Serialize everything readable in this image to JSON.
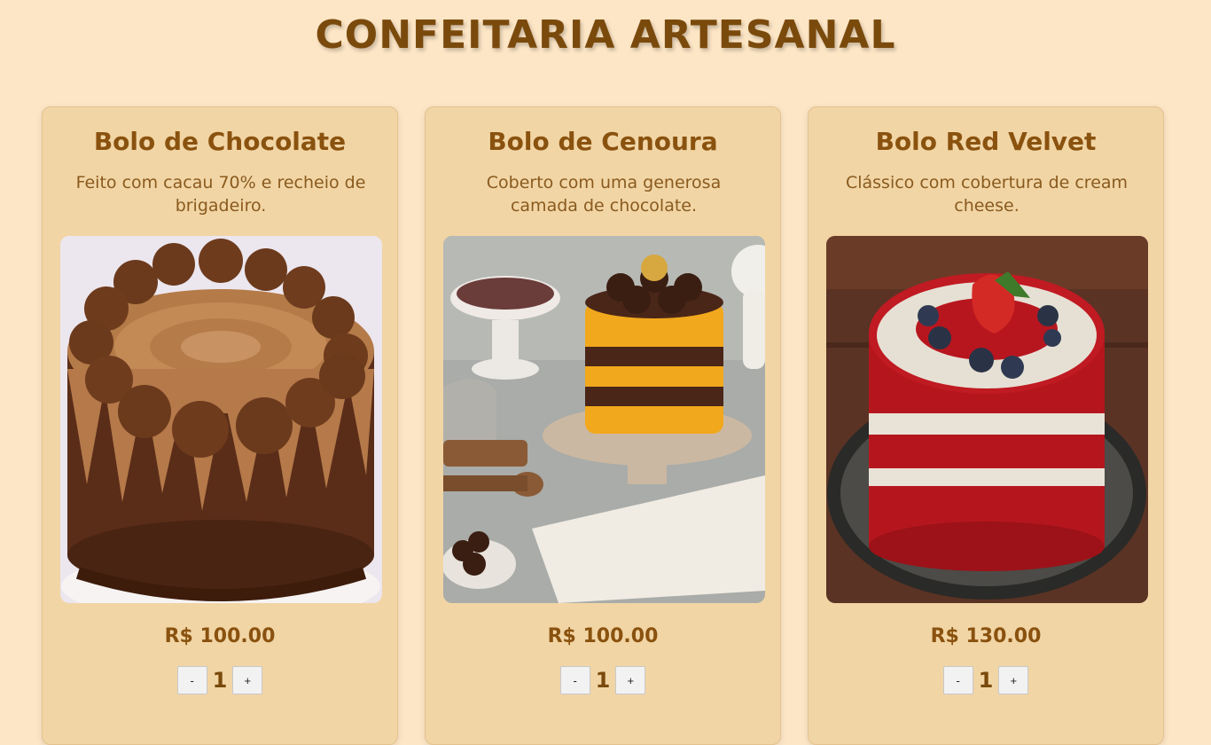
{
  "page": {
    "title": "CONFEITARIA ARTESANAL"
  },
  "products": [
    {
      "name": "Bolo de Chocolate",
      "description": "Feito com cacau 70% e recheio de brigadeiro.",
      "price": "R$ 100.00",
      "quantity": "1",
      "decrement_label": "-",
      "increment_label": "+"
    },
    {
      "name": "Bolo de Cenoura",
      "description": "Coberto com uma generosa camada de chocolate.",
      "price": "R$ 100.00",
      "quantity": "1",
      "decrement_label": "-",
      "increment_label": "+"
    },
    {
      "name": "Bolo Red Velvet",
      "description": "Clássico com cobertura de cream cheese.",
      "price": "R$ 130.00",
      "quantity": "1",
      "decrement_label": "-",
      "increment_label": "+"
    }
  ],
  "colors": {
    "background": "#fde6c6",
    "card": "#f1d5a5",
    "title": "#7a4a0c",
    "text": "#8a520f"
  }
}
